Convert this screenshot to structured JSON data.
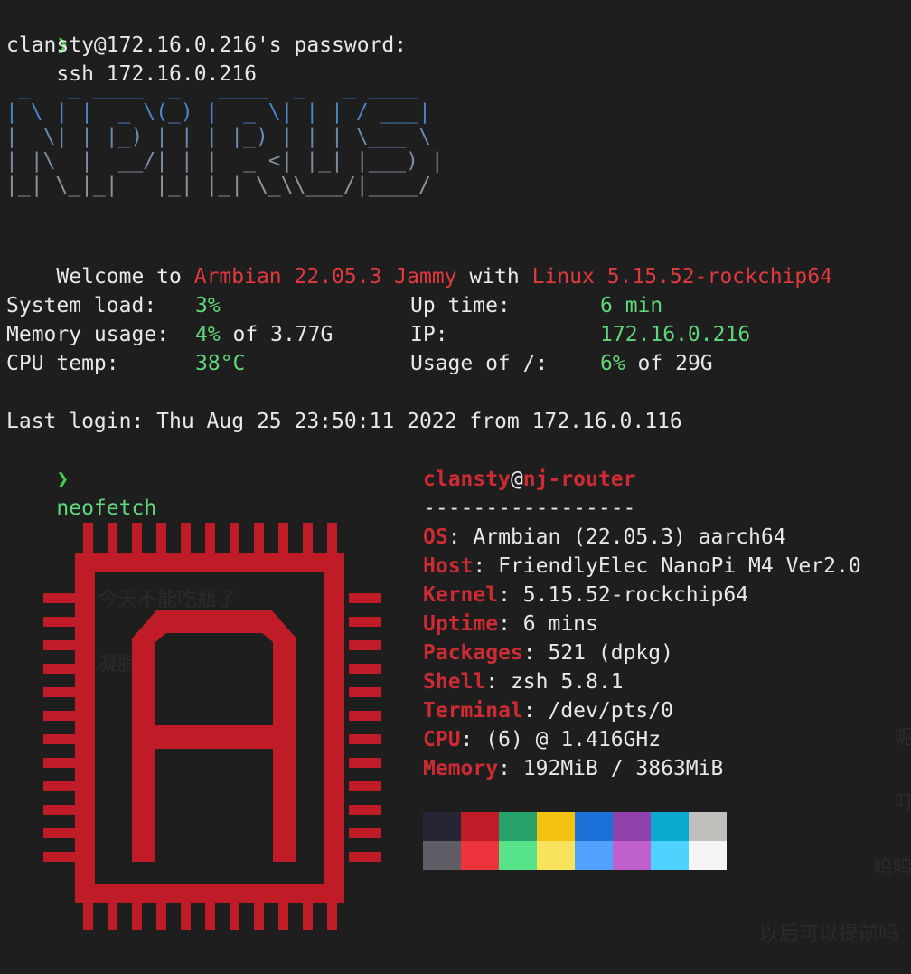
{
  "prompt_symbol": "❯",
  "ssh": {
    "command": "ssh 172.16.0.216",
    "password_prompt": "clansty@172.16.0.216's password:"
  },
  "banner_lines": [
    " _   _ ____  _   ____  _   _ ____  ",
    "| \\ | |  _ \\(_) |  _ \\| | | / ___| ",
    "|  \\| | |_) | | | |_) | | | \\___ \\ ",
    "| |\\  |  __/| | |  _ <| |_| |___) |",
    "|_| \\_|_|   |_| |_| \\_\\\\___/|____/ "
  ],
  "welcome": {
    "prefix": "Welcome to ",
    "distro": "Armbian 22.05.3 Jammy",
    "middle": " with ",
    "kernel": "Linux 5.15.52-rockchip64"
  },
  "stats": [
    {
      "label": "System load:",
      "value": "3%",
      "suffix": ""
    },
    {
      "label": "Memory usage:",
      "value": "4%",
      "suffix": " of 3.77G"
    },
    {
      "label": "CPU temp:",
      "value": "38°C",
      "suffix": ""
    },
    {
      "label": "Up time:",
      "value": "6 min",
      "suffix": ""
    },
    {
      "label": "IP:",
      "value": "172.16.0.216",
      "suffix": ""
    },
    {
      "label": "Usage of /:",
      "value": "6%",
      "suffix": " of 29G"
    }
  ],
  "last_login": "Last login: Thu Aug 25 23:50:11 2022 from 172.16.0.116",
  "neofetch_command": "neofetch",
  "neofetch": {
    "user": "clansty",
    "at": "@",
    "host": "nj-router",
    "separator": "-----------------",
    "fields": [
      {
        "key": "OS",
        "value": "Armbian (22.05.3) aarch64"
      },
      {
        "key": "Host",
        "value": "FriendlyElec NanoPi M4 Ver2.0"
      },
      {
        "key": "Kernel",
        "value": "5.15.52-rockchip64"
      },
      {
        "key": "Uptime",
        "value": "6 mins"
      },
      {
        "key": "Packages",
        "value": "521 (dpkg)"
      },
      {
        "key": "Shell",
        "value": "zsh 5.8.1"
      },
      {
        "key": "Terminal",
        "value": "/dev/pts/0"
      },
      {
        "key": "CPU",
        "value": "(6) @ 1.416GHz"
      },
      {
        "key": "Memory",
        "value": "192MiB / 3863MiB"
      }
    ],
    "palette_dark": [
      "#272436",
      "#c01c28",
      "#26a269",
      "#f5c211",
      "#1c71d8",
      "#9141ac",
      "#0aaad0",
      "#c0bfbc"
    ],
    "palette_bright": [
      "#5e5c64",
      "#ed333b",
      "#57e389",
      "#f8e45c",
      "#51a1ff",
      "#c061cb",
      "#4fd2fd",
      "#f6f5f4"
    ]
  },
  "logo_icon": "armbian-chip-logo-icon",
  "colors": {
    "prompt": "#3fcf4a",
    "accent_red": "#e0393e",
    "value_green": "#5fd77a",
    "neofetch_key": "#cc2b33",
    "logo_red": "#c01c28"
  },
  "background_text": [
    "今天不能吃瓶了",
    "凝脂",
    "以后可以提前吗",
    "呜呜",
    "叮",
    "呢"
  ]
}
